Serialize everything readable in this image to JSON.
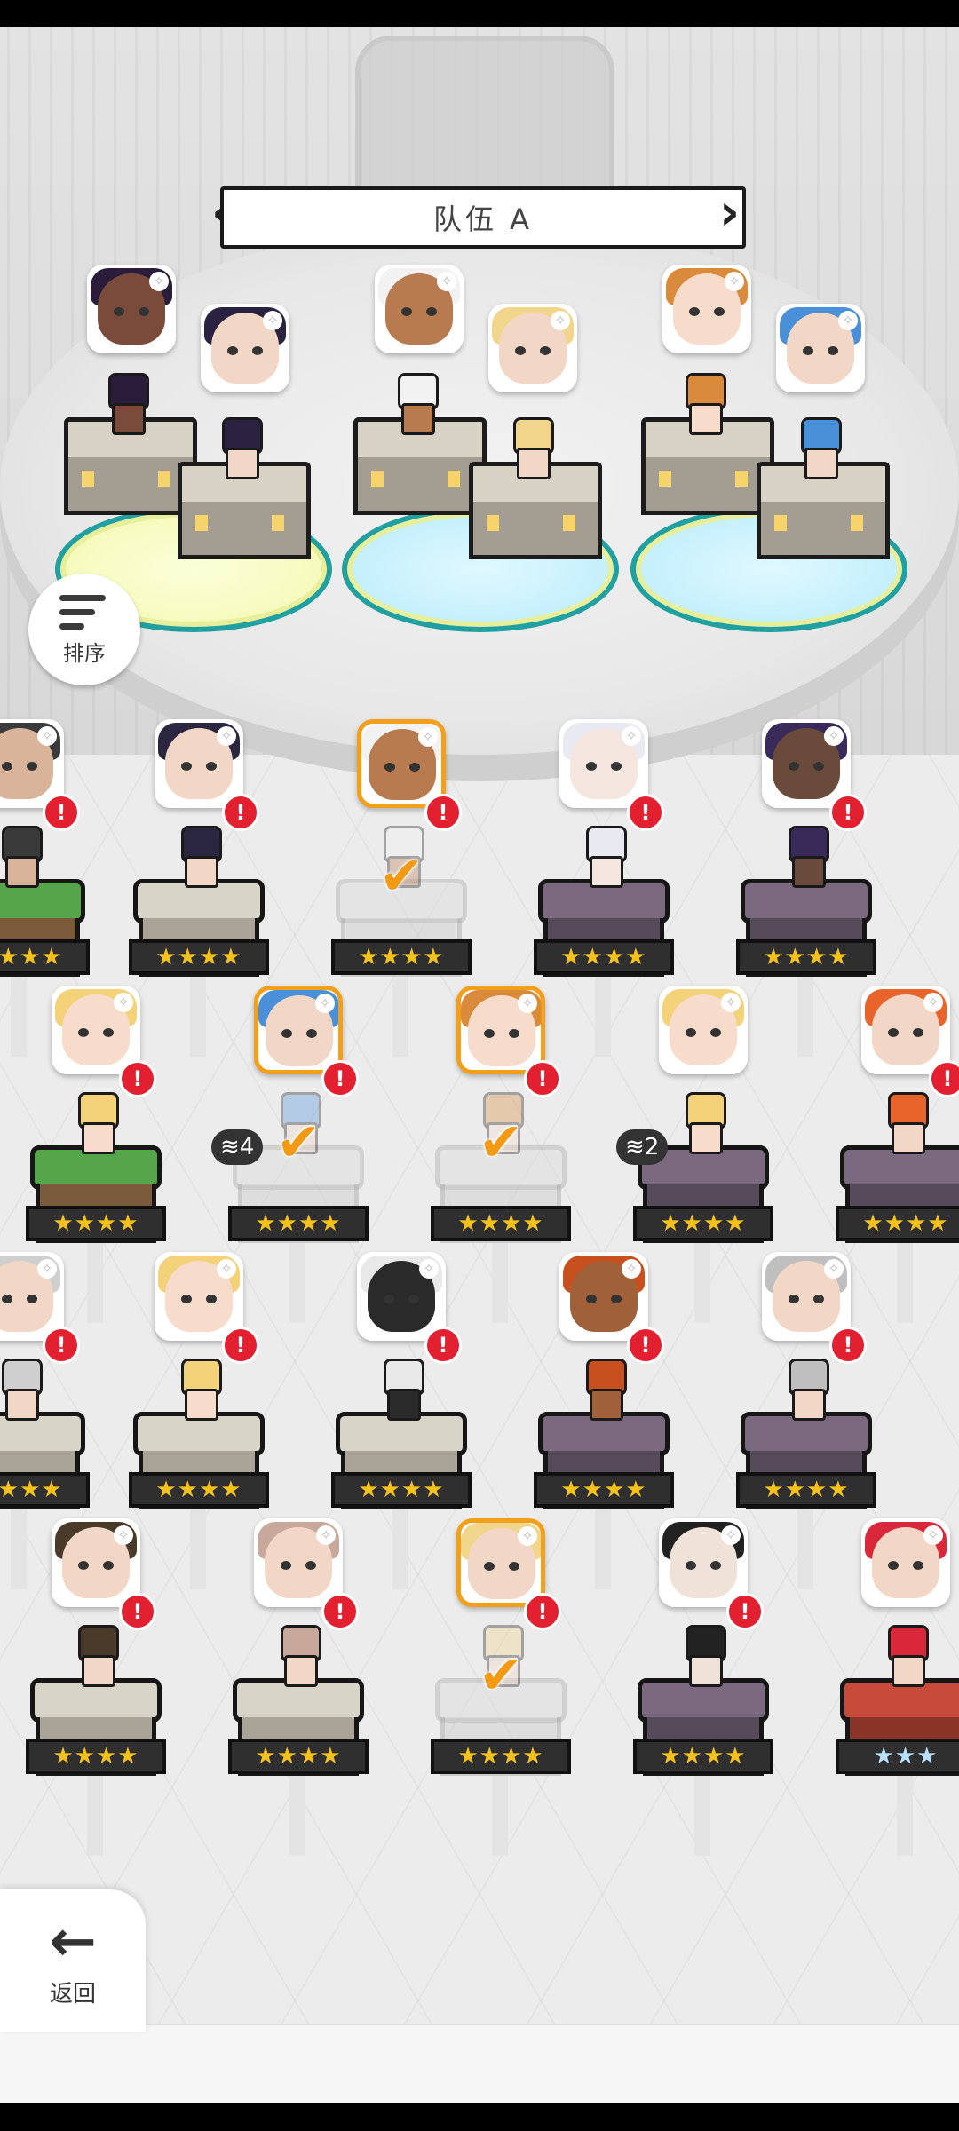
{
  "title": "队伍 A",
  "sort_label": "排序",
  "back_label": "返回",
  "check_glyph": "✔",
  "alert_glyph": "!",
  "team": [
    {
      "hair": "#2b1d3a",
      "skin": "#7a4a3a"
    },
    {
      "hair": "#2a2240",
      "skin": "#f3d7c6"
    },
    {
      "hair": "#f2f2f2",
      "skin": "#b87a4f"
    },
    {
      "hair": "#f1d58a",
      "skin": "#f3d7c6"
    },
    {
      "hair": "#d98a3a",
      "skin": "#f7dccb"
    },
    {
      "hair": "#4a90d8",
      "skin": "#f3d7c6"
    }
  ],
  "roster": [
    {
      "row": 0,
      "col": 0,
      "hair": "#3a3a3a",
      "skin": "#d9b39a",
      "base": "green",
      "stars": "★★★★",
      "alert": true,
      "selected": false
    },
    {
      "row": 0,
      "col": 1,
      "hair": "#2a2640",
      "skin": "#f3d7c6",
      "base": "grey",
      "stars": "★★★★",
      "alert": true,
      "selected": false
    },
    {
      "row": 0,
      "col": 2,
      "hair": "#f2f2f2",
      "skin": "#b87a4f",
      "base": "ghost",
      "stars": "★★★★",
      "alert": true,
      "selected": true,
      "check": true
    },
    {
      "row": 0,
      "col": 3,
      "hair": "#e9e9f2",
      "skin": "#f5e6e0",
      "base": "purple",
      "stars": "★★★★",
      "alert": true,
      "selected": false
    },
    {
      "row": 0,
      "col": 4,
      "hair": "#3a2a5a",
      "skin": "#6a4a3a",
      "base": "purple",
      "stars": "★★★★",
      "alert": true,
      "selected": false
    },
    {
      "row": 1,
      "col": 0,
      "hair": "#f3d27a",
      "skin": "#f7dccb",
      "base": "green",
      "stars": "★★★★",
      "alert": true,
      "selected": false
    },
    {
      "row": 1,
      "col": 1,
      "hair": "#4a90d8",
      "skin": "#f3d7c6",
      "base": "ghost",
      "stars": "★★★★",
      "alert": true,
      "selected": true,
      "check": true,
      "tier": "4"
    },
    {
      "row": 1,
      "col": 2,
      "hair": "#d98a3a",
      "skin": "#f7dccb",
      "base": "ghost",
      "stars": "★★★★",
      "alert": true,
      "selected": true,
      "check": true
    },
    {
      "row": 1,
      "col": 3,
      "hair": "#f3d27a",
      "skin": "#f7dccb",
      "base": "purple",
      "stars": "★★★★",
      "alert": false,
      "selected": false,
      "tier": "2"
    },
    {
      "row": 1,
      "col": 4,
      "hair": "#e8642a",
      "skin": "#f3d7c6",
      "base": "purple",
      "stars": "★★★★",
      "alert": true,
      "selected": false
    },
    {
      "row": 2,
      "col": 0,
      "hair": "#cfcfcf",
      "skin": "#f3d7c6",
      "base": "grey",
      "stars": "★★★★",
      "alert": true,
      "selected": false
    },
    {
      "row": 2,
      "col": 1,
      "hair": "#f3d27a",
      "skin": "#f7dccb",
      "base": "grey",
      "stars": "★★★★",
      "alert": true,
      "selected": false
    },
    {
      "row": 2,
      "col": 2,
      "hair": "#e9e9e9",
      "skin": "#2a2a2a",
      "base": "grey",
      "stars": "★★★★",
      "alert": true,
      "selected": false
    },
    {
      "row": 2,
      "col": 3,
      "hair": "#c8501e",
      "skin": "#a0603a",
      "base": "purple",
      "stars": "★★★★",
      "alert": true,
      "selected": false
    },
    {
      "row": 2,
      "col": 4,
      "hair": "#bfbfbf",
      "skin": "#f3d7c6",
      "base": "purple",
      "stars": "★★★★",
      "alert": true,
      "selected": false
    },
    {
      "row": 3,
      "col": 0,
      "hair": "#4a3a2a",
      "skin": "#f3d7c6",
      "base": "grey",
      "stars": "★★★★",
      "alert": true,
      "selected": false
    },
    {
      "row": 3,
      "col": 1,
      "hair": "#c8a89a",
      "skin": "#f3d7c6",
      "base": "grey",
      "stars": "★★★★",
      "alert": true,
      "selected": false
    },
    {
      "row": 3,
      "col": 2,
      "hair": "#f1d58a",
      "skin": "#f3d7c6",
      "base": "ghost",
      "stars": "★★★★",
      "alert": true,
      "selected": true,
      "check": true
    },
    {
      "row": 3,
      "col": 3,
      "hair": "#222222",
      "skin": "#efe2d8",
      "base": "purple",
      "stars": "★★★★",
      "alert": true,
      "selected": false
    },
    {
      "row": 3,
      "col": 4,
      "hair": "#d8283a",
      "skin": "#f3d7c6",
      "base": "red",
      "stars": "★★★",
      "alert": false,
      "selected": false
    }
  ]
}
